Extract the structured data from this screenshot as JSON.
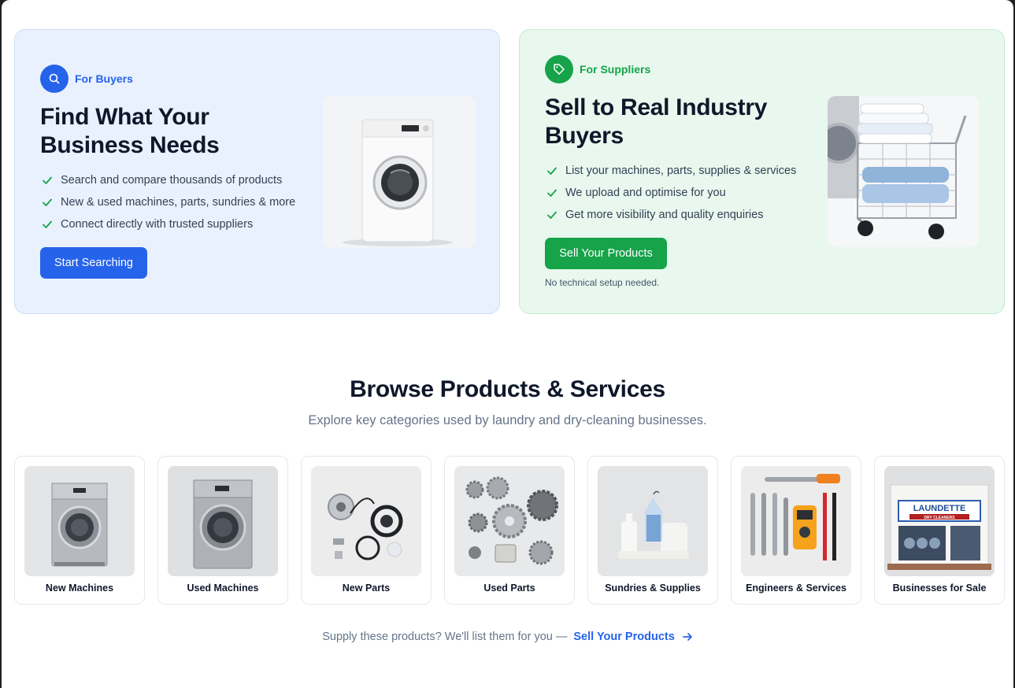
{
  "buyers": {
    "badge": "For Buyers",
    "badge_icon": "search-icon",
    "title_line1": "Find What Your",
    "title_line2": "Business Needs",
    "points": [
      "Search and compare thousands of products",
      "New & used machines, parts, sundries & more",
      "Connect directly with trusted suppliers"
    ],
    "cta": "Start Searching"
  },
  "suppliers": {
    "badge": "For Suppliers",
    "badge_icon": "tag-icon",
    "title_line1": "Sell to Real Industry",
    "title_line2": "Buyers",
    "points": [
      "List your machines, parts, supplies & services",
      "We upload and optimise for you",
      "Get more visibility and quality enquiries"
    ],
    "cta": "Sell Your Products",
    "note": "No technical setup needed."
  },
  "browse": {
    "title": "Browse Products & Services",
    "subtitle": "Explore key categories used by laundry and dry-cleaning businesses.",
    "categories": [
      {
        "label": "New Machines"
      },
      {
        "label": "Used Machines"
      },
      {
        "label": "New Parts"
      },
      {
        "label": "Used Parts"
      },
      {
        "label": "Sundries & Supplies"
      },
      {
        "label": "Engineers & Services"
      },
      {
        "label": "Businesses for Sale"
      }
    ],
    "shop_sign": "LAUNDETTE",
    "shop_subsign": "DRY CLEANERS"
  },
  "footer": {
    "text": "Supply these products? We'll list them for you —",
    "link": "Sell Your Products",
    "link_icon": "arrow-right-icon"
  },
  "colors": {
    "primary_blue": "#2563eb",
    "primary_green": "#16a34a",
    "buyers_bg": "#eaf1fe",
    "suppliers_bg": "#e8f8ee"
  }
}
